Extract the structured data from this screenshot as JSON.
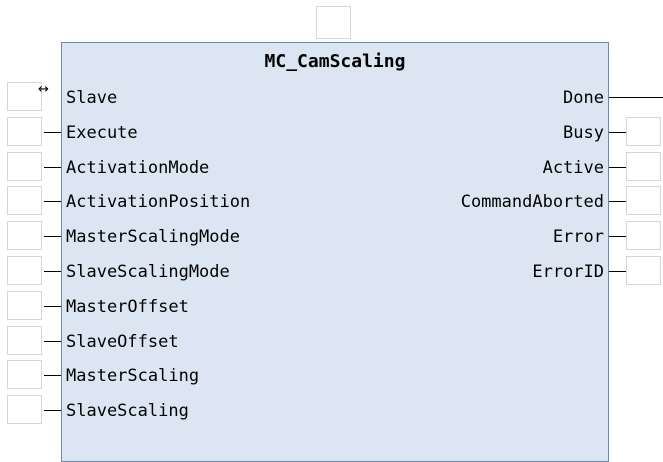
{
  "block": {
    "title": "MC_CamScaling",
    "inout_marker": "↔",
    "inputs": [
      {
        "label": "Slave",
        "kind": "inout"
      },
      {
        "label": "Execute",
        "kind": "in"
      },
      {
        "label": "ActivationMode",
        "kind": "in"
      },
      {
        "label": "ActivationPosition",
        "kind": "in"
      },
      {
        "label": "MasterScalingMode",
        "kind": "in"
      },
      {
        "label": "SlaveScalingMode",
        "kind": "in"
      },
      {
        "label": "MasterOffset",
        "kind": "in"
      },
      {
        "label": "SlaveOffset",
        "kind": "in"
      },
      {
        "label": "MasterScaling",
        "kind": "in"
      },
      {
        "label": "SlaveScaling",
        "kind": "in"
      }
    ],
    "outputs": [
      {
        "label": "Done",
        "kind": "inout"
      },
      {
        "label": "Busy",
        "kind": "out"
      },
      {
        "label": "Active",
        "kind": "out"
      },
      {
        "label": "CommandAborted",
        "kind": "out"
      },
      {
        "label": "Error",
        "kind": "out"
      },
      {
        "label": "ErrorID",
        "kind": "out"
      }
    ]
  },
  "colors": {
    "block_fill": "#dce6f2",
    "block_border": "#6f86ad"
  }
}
